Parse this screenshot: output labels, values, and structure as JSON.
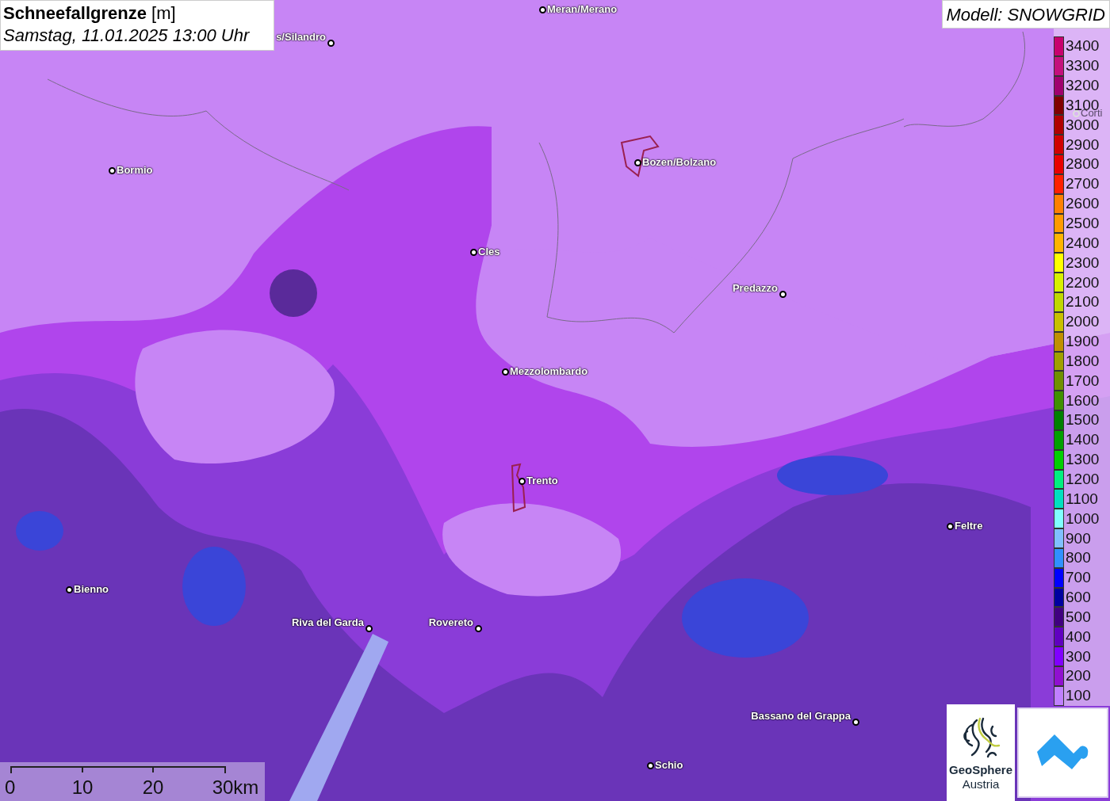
{
  "title": {
    "name": "Schneefallgrenze",
    "unit": "[m]",
    "datetime": "Samstag, 11.01.2025 13:00 Uhr"
  },
  "model": "Modell: SNOWGRID",
  "legend": [
    {
      "label": "3400",
      "color": "#c8006e"
    },
    {
      "label": "3300",
      "color": "#c4107c"
    },
    {
      "label": "3200",
      "color": "#a0006e"
    },
    {
      "label": "3100",
      "color": "#800000"
    },
    {
      "label": "3000",
      "color": "#b00000"
    },
    {
      "label": "2900",
      "color": "#d00000"
    },
    {
      "label": "2800",
      "color": "#e80000"
    },
    {
      "label": "2700",
      "color": "#ff2000"
    },
    {
      "label": "2600",
      "color": "#ff8000"
    },
    {
      "label": "2500",
      "color": "#ff9a00"
    },
    {
      "label": "2400",
      "color": "#ffb400"
    },
    {
      "label": "2300",
      "color": "#ffff00"
    },
    {
      "label": "2200",
      "color": "#d8f000"
    },
    {
      "label": "2100",
      "color": "#c0d800"
    },
    {
      "label": "2000",
      "color": "#c8c000"
    },
    {
      "label": "1900",
      "color": "#c09000"
    },
    {
      "label": "1800",
      "color": "#a0a000"
    },
    {
      "label": "1700",
      "color": "#709000"
    },
    {
      "label": "1600",
      "color": "#409000"
    },
    {
      "label": "1500",
      "color": "#008000"
    },
    {
      "label": "1400",
      "color": "#00a000"
    },
    {
      "label": "1300",
      "color": "#00d000"
    },
    {
      "label": "1200",
      "color": "#00f080"
    },
    {
      "label": "1100",
      "color": "#00e0c0"
    },
    {
      "label": "1000",
      "color": "#80ffff"
    },
    {
      "label": "900",
      "color": "#80c0ff"
    },
    {
      "label": "800",
      "color": "#3090ff"
    },
    {
      "label": "700",
      "color": "#0000ff"
    },
    {
      "label": "600",
      "color": "#0000a0"
    },
    {
      "label": "500",
      "color": "#400080"
    },
    {
      "label": "400",
      "color": "#6000c0"
    },
    {
      "label": "300",
      "color": "#8000ff"
    },
    {
      "label": "200",
      "color": "#9010d0"
    },
    {
      "label": "100",
      "color": "#c080ff"
    }
  ],
  "cities": [
    {
      "name": "Meran/Merano",
      "faded": false
    },
    {
      "name": "s/Silandro",
      "faded": false
    },
    {
      "name": "Bormio",
      "faded": false
    },
    {
      "name": "Bozen/Bolzano",
      "faded": false
    },
    {
      "name": "Cles",
      "faded": false
    },
    {
      "name": "Predazzo",
      "faded": false
    },
    {
      "name": "Mezzolombardo",
      "faded": false
    },
    {
      "name": "Trento",
      "faded": false
    },
    {
      "name": "Feltre",
      "faded": false
    },
    {
      "name": "Bienno",
      "faded": false
    },
    {
      "name": "Riva del Garda",
      "faded": false
    },
    {
      "name": "Rovereto",
      "faded": false
    },
    {
      "name": "Bassano del Grappa",
      "faded": false
    },
    {
      "name": "Schio",
      "faded": false
    },
    {
      "name": "Corti",
      "faded": true
    }
  ],
  "scale_bar": [
    "0",
    "10",
    "20",
    "30km"
  ],
  "logo": {
    "name": "GeoSphere",
    "subtitle": "Austria"
  }
}
